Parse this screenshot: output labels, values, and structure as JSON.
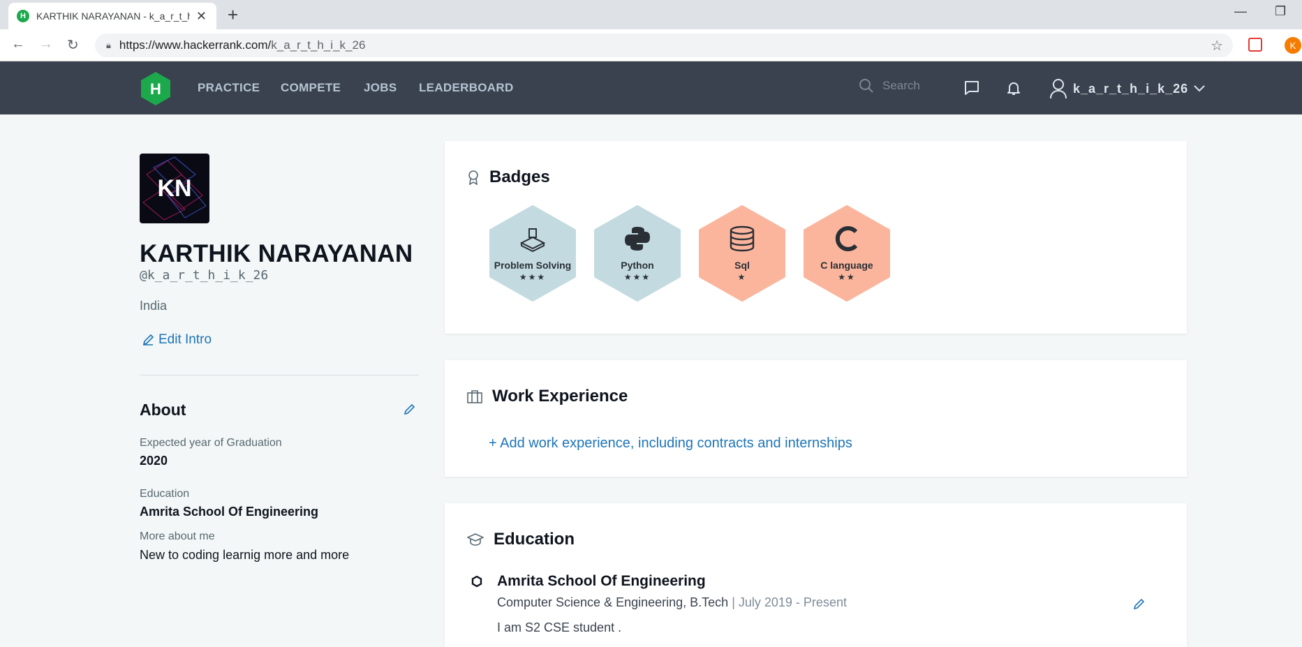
{
  "browser": {
    "tab_title": "KARTHIK NARAYANAN - k_a_r_t_h_i_k_26",
    "tab_icon_letter": "H",
    "url_host": "https://www.hackerrank.com/",
    "url_path": "k_a_r_t_h_i_k_26",
    "profile_initial": "K"
  },
  "nav": {
    "links": [
      "PRACTICE",
      "COMPETE",
      "JOBS",
      "LEADERBOARD"
    ],
    "search_placeholder": "Search",
    "username": "k_a_r_t_h_i_k_26"
  },
  "profile": {
    "initials": "KN",
    "name": "KARTHIK NARAYANAN",
    "handle": "@k_a_r_t_h_i_k_26",
    "country": "India",
    "edit_intro": "Edit Intro"
  },
  "about": {
    "title": "About",
    "fields": [
      {
        "label": "Expected year of Graduation",
        "value": "2020"
      },
      {
        "label": "Education",
        "value": "Amrita School Of Engineering"
      },
      {
        "label": "More about me",
        "value": "New to coding learnig more and more"
      }
    ]
  },
  "badges": {
    "title": "Badges",
    "items": [
      {
        "name": "Problem Solving",
        "stars": "★★★",
        "icon": "problem-solving-icon",
        "color": "#c3dbe0"
      },
      {
        "name": "Python",
        "stars": "★★★",
        "icon": "python-icon",
        "color": "#c3dbe0"
      },
      {
        "name": "Sql",
        "stars": "★",
        "icon": "database-icon",
        "color": "#fbb59c"
      },
      {
        "name": "C language",
        "stars": "★★",
        "icon": "c-language-icon",
        "color": "#fbb59c"
      }
    ]
  },
  "work": {
    "title": "Work Experience",
    "add_link": "+ Add work experience, including contracts and internships"
  },
  "education": {
    "title": "Education",
    "school": "Amrita School Of Engineering",
    "degree": "Computer Science & Engineering, B.Tech",
    "date": "| July 2019 - Present",
    "description": "I am S2 CSE student ."
  },
  "colors": {
    "nav_bg": "#39424e",
    "brand_green": "#1ba94c",
    "link_blue": "#1d74b8",
    "page_bg": "#f3f7f7"
  }
}
